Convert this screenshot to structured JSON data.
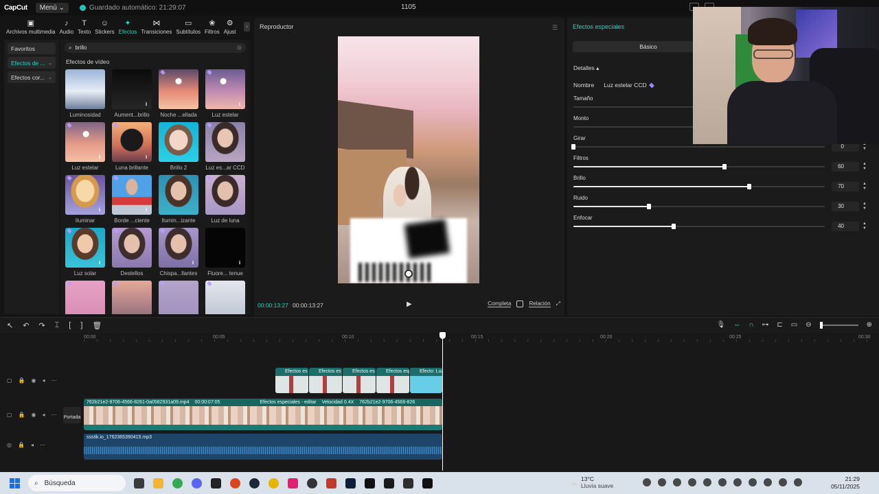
{
  "titlebar": {
    "logo": "CapCut",
    "menu": "Menú",
    "autosave": "Guardado automático: 21:29:07",
    "project": "1105"
  },
  "tools": [
    {
      "icon": "media-icon",
      "glyph": "▣",
      "label": "Archivos multimedia"
    },
    {
      "icon": "audio-icon",
      "glyph": "♪",
      "label": "Audio"
    },
    {
      "icon": "text-icon",
      "glyph": "T",
      "label": "Texto"
    },
    {
      "icon": "sticker-icon",
      "glyph": "☺",
      "label": "Stickers"
    },
    {
      "icon": "effects-icon",
      "glyph": "✦",
      "label": "Efectos",
      "active": true
    },
    {
      "icon": "transition-icon",
      "glyph": "⋈",
      "label": "Transiciones"
    },
    {
      "icon": "subtitle-icon",
      "glyph": "▭",
      "label": "Subtítulos"
    },
    {
      "icon": "filter-icon",
      "glyph": "❀",
      "label": "Filtros"
    },
    {
      "icon": "adjust-icon",
      "glyph": "⚙",
      "label": "Ajust"
    }
  ],
  "sidebar": [
    {
      "label": "Favoritos",
      "chev": ""
    },
    {
      "label": "Efectos de ...",
      "chev": "⌄",
      "active": true
    },
    {
      "label": "Efectos cor...",
      "chev": "⌄"
    }
  ],
  "effects": {
    "search_value": "brillo",
    "section": "Efectos de vídeo",
    "items": [
      {
        "label": "Luminosidad",
        "thumb": "t1"
      },
      {
        "label": "Aument...brillo",
        "thumb": "t2",
        "download": true
      },
      {
        "label": "Noche ...ellada",
        "thumb": "t3",
        "premium": true
      },
      {
        "label": "Luz estelar",
        "thumb": "t4",
        "premium": true,
        "download": true
      },
      {
        "label": "Luz estelar",
        "thumb": "t5",
        "premium": true,
        "download": true
      },
      {
        "label": "Luna brillante",
        "thumb": "t6",
        "premium": true,
        "download": true
      },
      {
        "label": "Brillo 2",
        "thumb": "t7"
      },
      {
        "label": "Luz es...ar CCD",
        "thumb": "t8",
        "premium": true
      },
      {
        "label": "Iluminar",
        "thumb": "t9",
        "premium": true,
        "download": true
      },
      {
        "label": "Borde ...ciente",
        "thumb": "t10",
        "premium": true,
        "download": true
      },
      {
        "label": "Ilumin...izante",
        "thumb": "t11"
      },
      {
        "label": "Luz de luna",
        "thumb": "t12",
        "premium": true
      },
      {
        "label": "Luz solar",
        "thumb": "t13",
        "premium": true,
        "download": true
      },
      {
        "label": "Destellos",
        "thumb": "t14",
        "premium": true
      },
      {
        "label": "Chispa...llantes",
        "thumb": "t15",
        "premium": true,
        "download": true
      },
      {
        "label": "Fluore... tenue",
        "thumb": "t16",
        "download": true
      },
      {
        "label": "",
        "thumb": "t17",
        "premium": true
      },
      {
        "label": "",
        "thumb": "t18",
        "premium": true
      },
      {
        "label": "",
        "thumb": "t19",
        "premium": true
      },
      {
        "label": "",
        "thumb": "t20",
        "premium": true
      }
    ]
  },
  "player": {
    "title": "Reproductor",
    "time_current": "00:00:13:27",
    "time_total": "00:00:13:27",
    "full_label": "Completa",
    "ratio_label": "Relación"
  },
  "props": {
    "title": "Efectos especiales",
    "tab": "Básico",
    "details": "Detalles ▴",
    "name_label": "Nombre",
    "name_value": "Luz estelar CCD",
    "params": [
      {
        "label": "Tamaño",
        "value": "",
        "fraction": null
      },
      {
        "label": "Monto",
        "value": "",
        "fraction": null
      },
      {
        "label": "Girar",
        "value": "0",
        "fraction": 0.0
      },
      {
        "label": "Filtros",
        "value": "60",
        "fraction": 0.6
      },
      {
        "label": "Brillo",
        "value": "70",
        "fraction": 0.7
      },
      {
        "label": "Ruido",
        "value": "30",
        "fraction": 0.3
      },
      {
        "label": "Enfocar",
        "value": "40",
        "fraction": 0.4
      }
    ]
  },
  "timeline": {
    "ruler": [
      "00:00",
      "00:05",
      "00:10",
      "00:15",
      "00:20",
      "00:25",
      "00:30"
    ],
    "fx_clips": [
      {
        "label": "Efectos es"
      },
      {
        "label": "Efectos es"
      },
      {
        "label": "Efectos es"
      },
      {
        "label": "Efectos esp"
      },
      {
        "label": "Efecto: Luz"
      }
    ],
    "main_clip_name": "762b21e2-9706-4566-8261-0a0582931a09.mp4",
    "main_clip_time": "00:00:07:05",
    "main_clip_fx": "Efectos especiales - editar",
    "main_clip_speed": "Velocidad 0.4X",
    "main_clip_name2": "762b21e2-9706-4566-826",
    "cover_label": "Portada",
    "audio_name": "ssstik.io_1762365390415.mp3"
  },
  "taskbar": {
    "search": "Búsqueda",
    "temp": "13°C",
    "weather": "Lluvia suave",
    "time": "21:29",
    "date": "05/11/2025"
  },
  "colors": {
    "accent": "#1fd6c8",
    "fx_clip": "#1a5b5a",
    "main_clip": "#186562",
    "audio_clip": "#1d4569"
  }
}
